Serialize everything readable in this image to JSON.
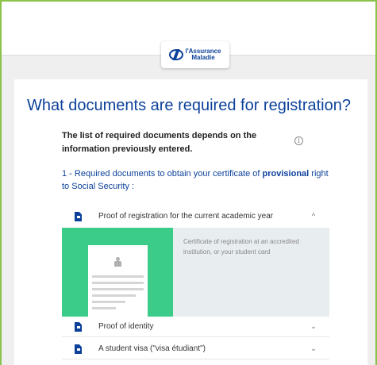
{
  "header": {
    "logo_line1": "l'Assurance",
    "logo_line2": "Maladie",
    "logo_icon": "assurance-maladie-logo"
  },
  "page": {
    "title": "What documents are required for registration?",
    "subtitle": "The list of required documents depends on the information previously entered.",
    "info_icon": "ⓘ",
    "step_prefix": "1 - Required documents to obtain your certificate of ",
    "step_bold": "provisional",
    "step_suffix": " right to Social Security :"
  },
  "accordion": {
    "items": [
      {
        "label": "Proof of registration for the current academic year",
        "icon": "document-icon",
        "state": "expanded",
        "chevron": "^"
      },
      {
        "label": "Proof of identity",
        "icon": "document-icon",
        "state": "collapsed",
        "chevron": "⌄"
      },
      {
        "label": "A student visa (\"visa étudiant\")",
        "icon": "document-icon",
        "state": "collapsed",
        "chevron": "⌄"
      }
    ],
    "panel_text": "Certificate of registration at an accredited institution, or your student card"
  },
  "colors": {
    "accent": "#0c419a",
    "frame_border": "#8bc34a",
    "panel_green": "#3ccc8a",
    "panel_bg": "#e8edf0"
  }
}
